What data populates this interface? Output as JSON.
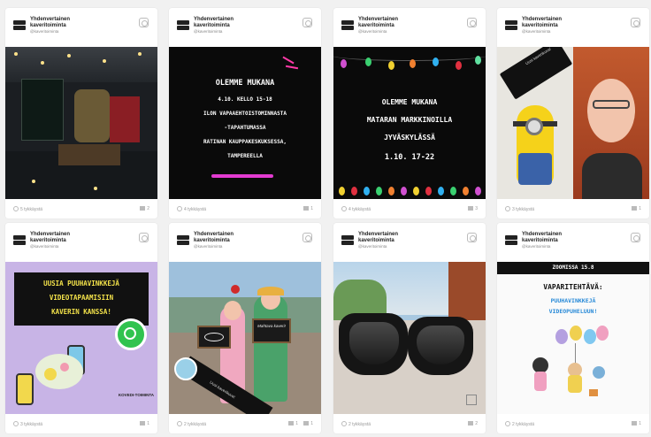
{
  "account": {
    "name": "Yhdenvertainen kaveritoiminta",
    "handle": "@kaveritoiminta"
  },
  "posts": [
    {
      "likes": "5 tykkäystä",
      "comments": "2"
    },
    {
      "likes": "4 tykkäystä",
      "comments": "1",
      "lines": [
        "OLEMME MUKANA",
        "4.10. KELLO 15-18",
        "ILON VAPAAEHTOISTOMINNASTA",
        "-TAPAHTUMASSA",
        "RATINAN KAUPPAKESKUKSESSA,",
        "TAMPEREELLA"
      ]
    },
    {
      "likes": "4 tykkäystä",
      "comments": "3",
      "lines": [
        "OLEMME MUKANA",
        "MATARAN MARKKINOILLA",
        "JYVÄSKYLÄSSÄ",
        "1.10. 17-22"
      ]
    },
    {
      "likes": "3 tykkäystä",
      "comments": "1",
      "sticker": "Uusi kaverikuva!"
    },
    {
      "likes": "3 tykkäystä",
      "comments": "1",
      "lines": [
        "UUSIA PUUHAVINKKEJÄ",
        "VIDEOTAPAAMISIIN",
        "KAVERIN KANSSA!"
      ],
      "brand": "KOVEDI-TOIMINTA"
    },
    {
      "likes": "2 tykkäystä",
      "comments": "1",
      "comments2": "1",
      "sign": "Mahtava kaveri!",
      "sticker": "Uusi kaverikuva!"
    },
    {
      "likes": "2 tykkäystä",
      "comments": "2"
    },
    {
      "likes": "2 tykkäystä",
      "comments": "1",
      "banner": "ZOOMISSA 15.8",
      "lines": [
        "VAPARITEHTÄVÄ:",
        "PUUHAVINKKEJÄ",
        "VIDEOPUHELUUN!"
      ]
    }
  ]
}
